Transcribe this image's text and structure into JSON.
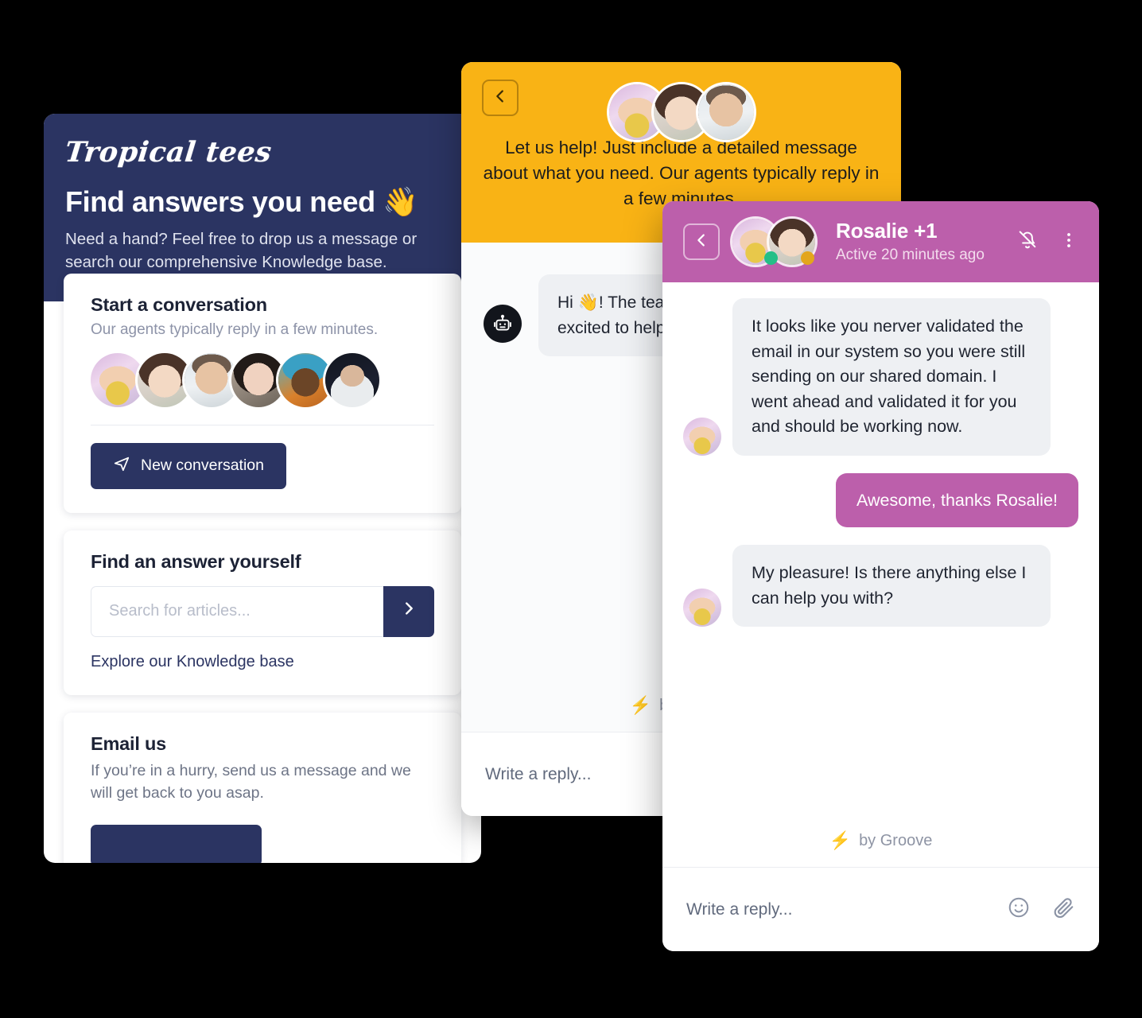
{
  "knowledge_panel": {
    "logo": "Tropical tees",
    "title": "Find answers you need 👋",
    "subtitle": "Need a hand? Feel free to drop us a message or search our comprehensive Knowledge base.",
    "conversation_card": {
      "heading": "Start a conversation",
      "subtext": "Our agents typically reply in a few minutes.",
      "agents": [
        "agent-hijab",
        "agent-asian-woman",
        "agent-man",
        "agent-dark-hair-woman",
        "agent-cap",
        "agent-night"
      ],
      "button_label": "New conversation",
      "button_icon": "send-icon"
    },
    "search_card": {
      "heading": "Find an answer yourself",
      "search_placeholder": "Search for articles...",
      "search_value": "",
      "submit_icon": "chevron-right-icon",
      "link_label": "Explore our Knowledge base"
    },
    "email_card": {
      "heading": "Email us",
      "body": "If you’re in a hurry, send us a message and we will get back to you asap.",
      "button_label": ""
    }
  },
  "bot_panel": {
    "back_icon": "chevron-left-icon",
    "avatars": [
      "agent-hijab",
      "agent-asian-woman",
      "agent-man"
    ],
    "headline": "Let us help! Just include a detailed message about what you need. Our agents typically reply in a few minutes.",
    "bot_avatar_icon": "robot-icon",
    "bot_message": "Hi 👋! The team at Tropical Tees is excited to help you",
    "footer": "by Groove",
    "footer_icon": "lightning-bolt-icon",
    "reply_placeholder": "Write a reply..."
  },
  "chat_panel": {
    "back_icon": "chevron-left-icon",
    "avatars": [
      "agent-hijab",
      "agent-asian-woman"
    ],
    "presence": [
      "online",
      "away"
    ],
    "title": "Rosalie +1",
    "status": "Active 20 minutes ago",
    "mute_icon": "bell-off-icon",
    "more_icon": "more-vertical-icon",
    "messages": [
      {
        "side": "in",
        "avatar": "agent-hijab",
        "text": "It looks like you nerver validated the email in our system so you were still sending on our shared domain. I went ahead and validated it for you and should be working now."
      },
      {
        "side": "out",
        "avatar": "",
        "text": "Awesome, thanks Rosalie!"
      },
      {
        "side": "in",
        "avatar": "agent-hijab",
        "text": "My pleasure! Is there anything else I can help you with?"
      }
    ],
    "footer": "by Groove",
    "footer_icon": "lightning-bolt-icon",
    "reply_placeholder": "Write a reply...",
    "emoji_icon": "emoji-icon",
    "attach_icon": "paperclip-icon"
  },
  "colors": {
    "navy": "#2b3462",
    "orange": "#f9b315",
    "purple": "#bc5fab",
    "bubble_grey": "#eef0f3",
    "presence_online": "#24bf87",
    "presence_away": "#e3a61c"
  }
}
